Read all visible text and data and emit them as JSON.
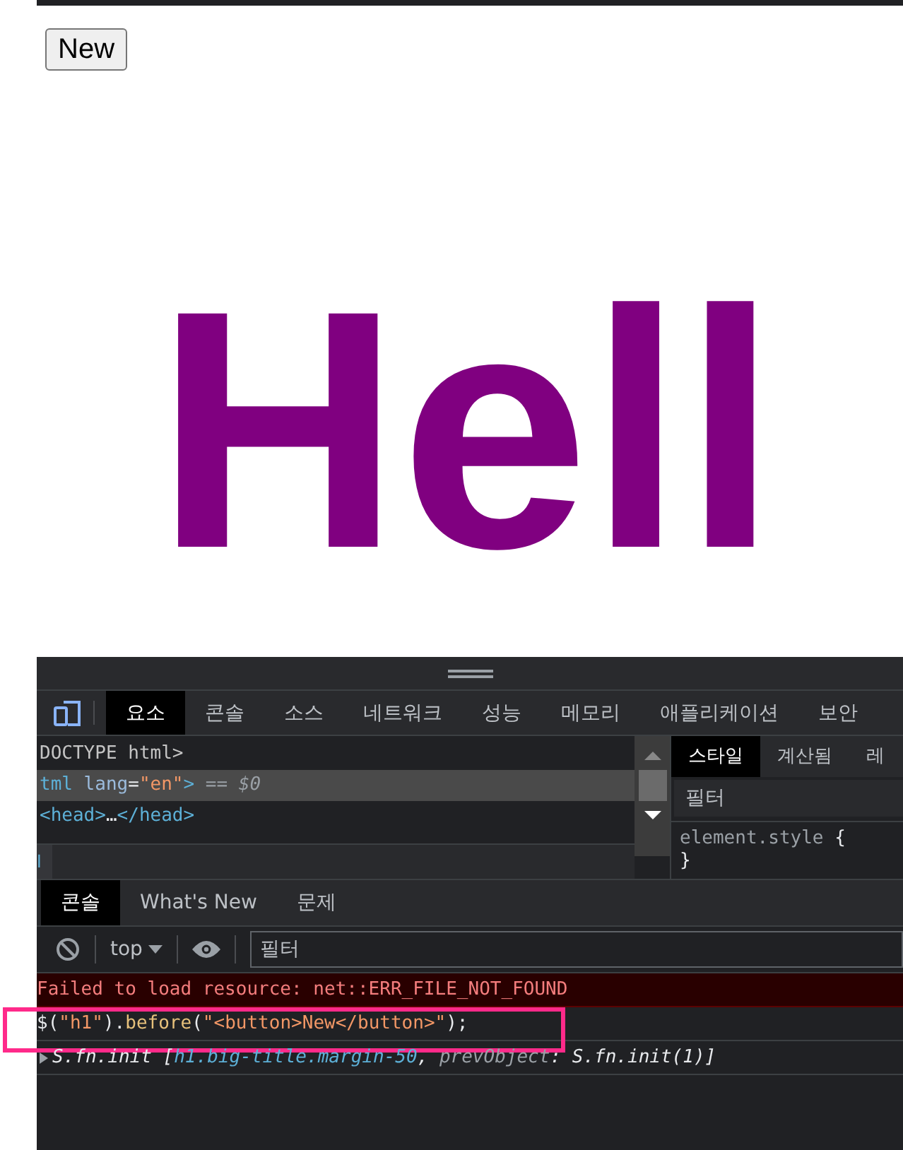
{
  "page": {
    "button": "New",
    "heading": "Hell"
  },
  "devtools": {
    "main_tabs": [
      {
        "label": "요소",
        "selected": true
      },
      {
        "label": "콘솔",
        "selected": false
      },
      {
        "label": "소스",
        "selected": false
      },
      {
        "label": "네트워크",
        "selected": false
      },
      {
        "label": "성능",
        "selected": false
      },
      {
        "label": "메모리",
        "selected": false
      },
      {
        "label": "애플리케이션",
        "selected": false
      },
      {
        "label": "보안",
        "selected": false
      }
    ],
    "dom_lines": [
      {
        "selected": false,
        "tokens": [
          {
            "text": "DOCTYPE html>",
            "kind": "doctype"
          }
        ]
      },
      {
        "selected": true,
        "tokens": [
          {
            "text": "tml",
            "kind": "tag"
          },
          {
            "text": " lang",
            "kind": "attr"
          },
          {
            "text": "=",
            "kind": "plain"
          },
          {
            "text": "\"en\"",
            "kind": "value"
          },
          {
            "text": ">",
            "kind": "tag"
          },
          {
            "text": " == $0",
            "kind": "hint"
          }
        ]
      },
      {
        "selected": false,
        "tokens": [
          {
            "text": "<head>",
            "kind": "tag"
          },
          {
            "text": "…",
            "kind": "plain"
          },
          {
            "text": "</head>",
            "kind": "tag"
          }
        ]
      }
    ],
    "breadcrumb": "l",
    "styles_tabs": [
      {
        "label": "스타일",
        "selected": true
      },
      {
        "label": "계산됨",
        "selected": false
      },
      {
        "label": "레",
        "selected": false
      }
    ],
    "styles_filter": {
      "placeholder": "필터"
    },
    "style_rule": {
      "selector": "element.style",
      "open": "{",
      "close": "}"
    },
    "drawer_tabs": [
      {
        "label": "콘솔",
        "selected": true
      },
      {
        "label": "What's New",
        "selected": false
      },
      {
        "label": "문제",
        "selected": false
      }
    ],
    "console_toolbar": {
      "context": "top",
      "filter": {
        "placeholder": "필터"
      }
    },
    "messages": [
      {
        "kind": "error",
        "highlighted": false,
        "tokens": [
          {
            "text": "Failed to load resource: net::ERR_FILE_NOT_FOUND",
            "kind": "error"
          }
        ]
      },
      {
        "kind": "command",
        "highlighted": true,
        "tokens": [
          {
            "text": "$(",
            "kind": "plain"
          },
          {
            "text": "\"h1\"",
            "kind": "string"
          },
          {
            "text": ").",
            "kind": "plain"
          },
          {
            "text": "before",
            "kind": "prop"
          },
          {
            "text": "(",
            "kind": "plain"
          },
          {
            "text": "\"<button>New</button>\"",
            "kind": "string"
          },
          {
            "text": ");",
            "kind": "plain"
          }
        ]
      },
      {
        "kind": "result",
        "highlighted": false,
        "expanded": false,
        "tokens": [
          {
            "text": "S.fn.init [",
            "kind": "plain"
          },
          {
            "text": "h1.big-title.margin-50",
            "kind": "tag"
          },
          {
            "text": ", ",
            "kind": "plain"
          },
          {
            "text": "prevObject",
            "kind": "key"
          },
          {
            "text": ": S.fn.init(1)]",
            "kind": "plain"
          }
        ]
      }
    ]
  }
}
